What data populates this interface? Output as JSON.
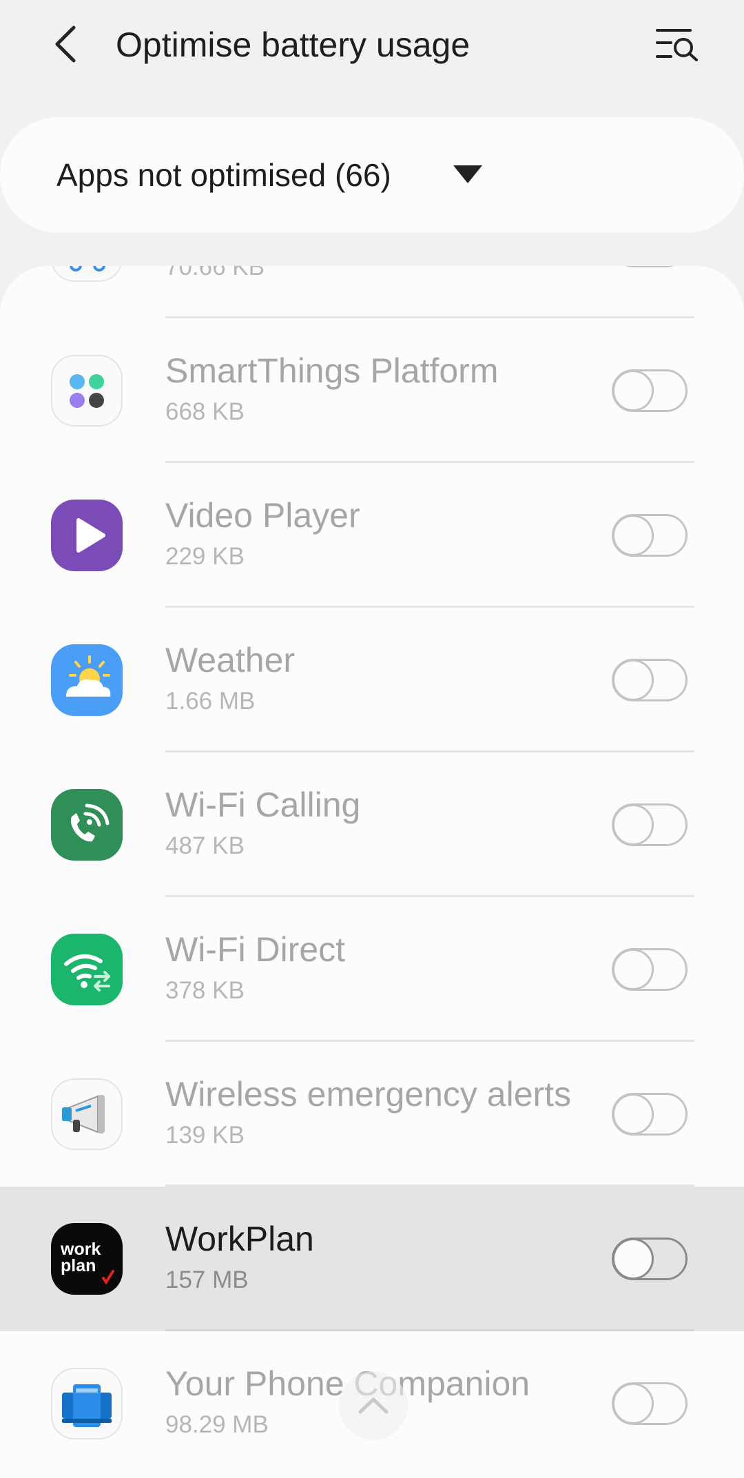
{
  "header": {
    "title": "Optimise battery usage"
  },
  "filter": {
    "label": "Apps not optimised (66)"
  },
  "apps": [
    {
      "name": "",
      "size": "70.66 KB",
      "icon": "partial-app-icon"
    },
    {
      "name": "SmartThings Platform",
      "size": "668 KB",
      "icon": "smartthings-icon"
    },
    {
      "name": "Video Player",
      "size": "229 KB",
      "icon": "video-player-icon"
    },
    {
      "name": "Weather",
      "size": "1.66 MB",
      "icon": "weather-icon"
    },
    {
      "name": "Wi-Fi Calling",
      "size": "487 KB",
      "icon": "wifi-calling-icon"
    },
    {
      "name": "Wi-Fi Direct",
      "size": "378 KB",
      "icon": "wifi-direct-icon"
    },
    {
      "name": "Wireless emergency alerts",
      "size": "139 KB",
      "icon": "emergency-alerts-icon"
    },
    {
      "name": "WorkPlan",
      "size": "157 MB",
      "icon": "workplan-icon",
      "logo_text": "work plan"
    },
    {
      "name": "Your Phone Companion",
      "size": "98.29 MB",
      "icon": "your-phone-icon"
    }
  ],
  "colors": {
    "video": "#7b4bb8",
    "weather": "#4a9ef5",
    "wifi_calling": "#2f8f57",
    "wifi_direct": "#1bb56b"
  }
}
